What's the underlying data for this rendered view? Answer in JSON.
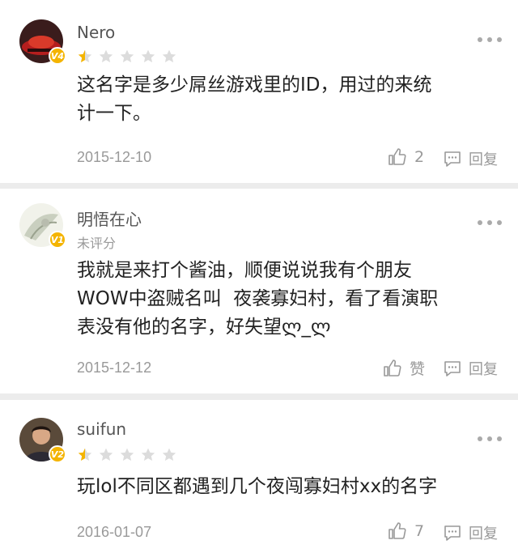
{
  "comments": [
    {
      "username": "Nero",
      "level": "V4",
      "rating_stars": 0.5,
      "rating_label": "",
      "text_lines": [
        "这名字是多少屌丝游戏里的ID，用过的来统",
        "计一下。"
      ],
      "date": "2015-12-10",
      "likes": "2",
      "reply_label": "回复"
    },
    {
      "username": "明悟在心",
      "level": "V1",
      "rating_label": "未评分",
      "text_lines": [
        "我就是来打个酱油，顺便说说我有个朋友",
        "WOW中盗贼名叫  夜袭寡妇村，看了看演职",
        "表没有他的名字，好失望ლ_ლ"
      ],
      "date": "2015-12-12",
      "likes": "赞",
      "reply_label": "回复"
    },
    {
      "username": "suifun",
      "level": "V2",
      "rating_stars": 0.5,
      "rating_label": "",
      "text_lines": [
        "玩lol不同区都遇到几个夜闯寡妇村xx的名字"
      ],
      "date": "2016-01-07",
      "likes": "7",
      "reply_label": "回复"
    }
  ],
  "colors": {
    "star_filled": "#f4b400",
    "star_empty": "#dcdcdc",
    "level_badge": "#f4b400",
    "meta_gray": "#999999"
  },
  "icons": {
    "like": "thumbs-up-icon",
    "reply": "comment-bubble-icon",
    "more": "more-dots-icon",
    "star": "star-icon"
  }
}
